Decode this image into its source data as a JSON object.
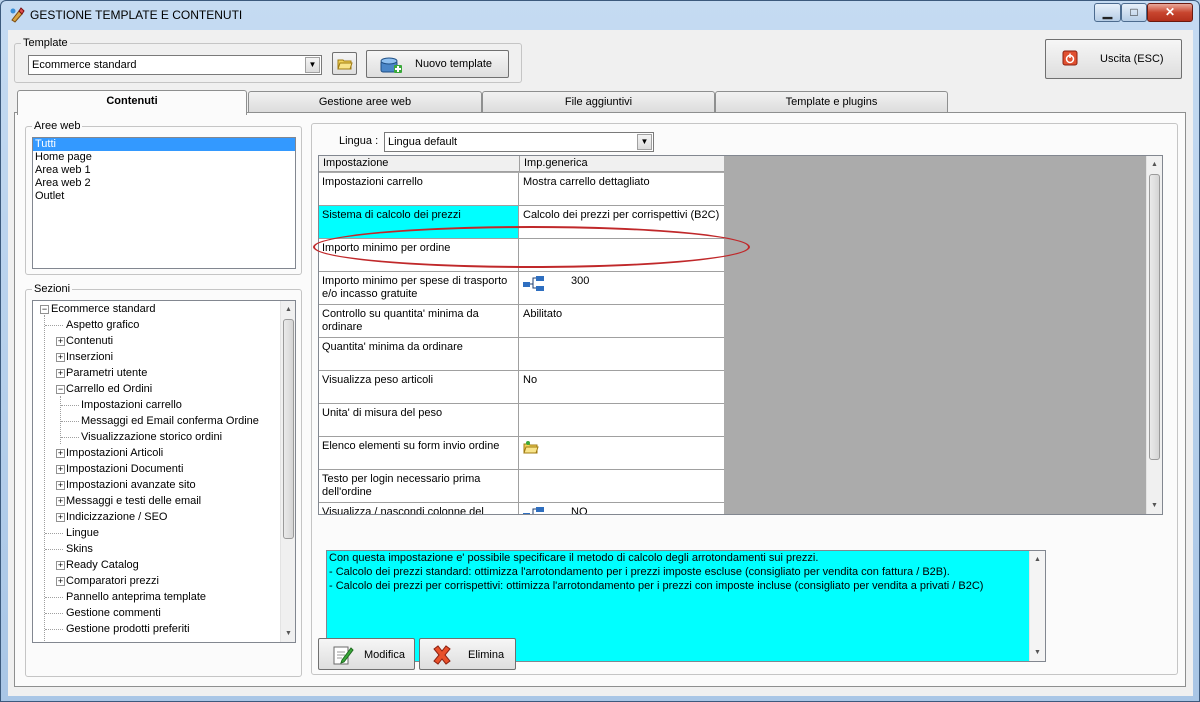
{
  "window": {
    "title": "GESTIONE TEMPLATE E CONTENUTI",
    "min_glyph": "▁",
    "max_glyph": "□",
    "close_glyph": "✕"
  },
  "template_group": {
    "label": "Template",
    "selected": "Ecommerce standard",
    "new_template_label": "Nuovo template"
  },
  "exit_button": {
    "label": "Uscita (ESC)"
  },
  "tabs": [
    {
      "label": "Contenuti",
      "active": true
    },
    {
      "label": "Gestione aree web",
      "active": false
    },
    {
      "label": "File aggiuntivi",
      "active": false
    },
    {
      "label": "Template e plugins",
      "active": false
    }
  ],
  "aree_web": {
    "label": "Aree web",
    "items": [
      "Tutti",
      "Home page",
      "Area web 1",
      "Area web 2",
      "Outlet"
    ],
    "selected_index": 0
  },
  "sezioni": {
    "label": "Sezioni",
    "root": "Ecommerce standard",
    "items": [
      "Aspetto grafico",
      "Contenuti",
      "Inserzioni",
      "Parametri utente",
      "Carrello ed Ordini",
      "Impostazioni carrello",
      "Messaggi ed Email conferma Ordine",
      "Visualizzazione storico ordini",
      "Impostazioni Articoli",
      "Impostazioni Documenti",
      "Impostazioni avanzate sito",
      "Messaggi e testi delle email",
      "Indicizzazione / SEO",
      "Lingue",
      "Skins",
      "Ready Catalog",
      "Comparatori prezzi",
      "Pannello anteprima template",
      "Gestione commenti",
      "Gestione prodotti preferiti"
    ]
  },
  "lingua": {
    "label": "Lingua :",
    "selected": "Lingua default"
  },
  "grid": {
    "headers": [
      "Impostazione",
      "Imp.generica"
    ],
    "rows": [
      {
        "name": "Impostazioni carrello",
        "value": "Mostra carrello dettagliato"
      },
      {
        "name": "Sistema di calcolo dei prezzi",
        "value": "Calcolo dei prezzi per corrispettivi (B2C)"
      },
      {
        "name": "Importo minimo per ordine",
        "value": ""
      },
      {
        "name": "Importo minimo per spese di trasporto e/o incasso gratuite",
        "value": "300"
      },
      {
        "name": "Controllo su quantita' minima da ordinare",
        "value": "Abilitato"
      },
      {
        "name": "Quantita' minima da ordinare",
        "value": ""
      },
      {
        "name": "Visualizza peso articoli",
        "value": "No"
      },
      {
        "name": "Unita' di misura del peso",
        "value": ""
      },
      {
        "name": "Elenco elementi su form invio ordine",
        "value": ""
      },
      {
        "name": "Testo per login necessario prima dell'ordine",
        "value": ""
      },
      {
        "name": "Visualizza / nascondi colonne del",
        "value": "NO"
      }
    ]
  },
  "description": {
    "lines": [
      "Con questa impostazione e' possibile specificare il metodo di calcolo degli arrotondamenti sui prezzi.",
      "- Calcolo dei prezzi standard: ottimizza l'arrotondamento per i prezzi imposte escluse (consigliato per vendita con fattura / B2B).",
      "- Calcolo dei prezzi per corrispettivi: ottimizza l'arrotondamento per i prezzi con imposte incluse (consigliato per vendita a privati / B2C)"
    ]
  },
  "actions": {
    "modifica_label": "Modifica",
    "elimina_label": "Elimina"
  },
  "colors": {
    "highlight": "#00ffff",
    "selection": "#3399ff",
    "annotation": "#c0282a"
  }
}
